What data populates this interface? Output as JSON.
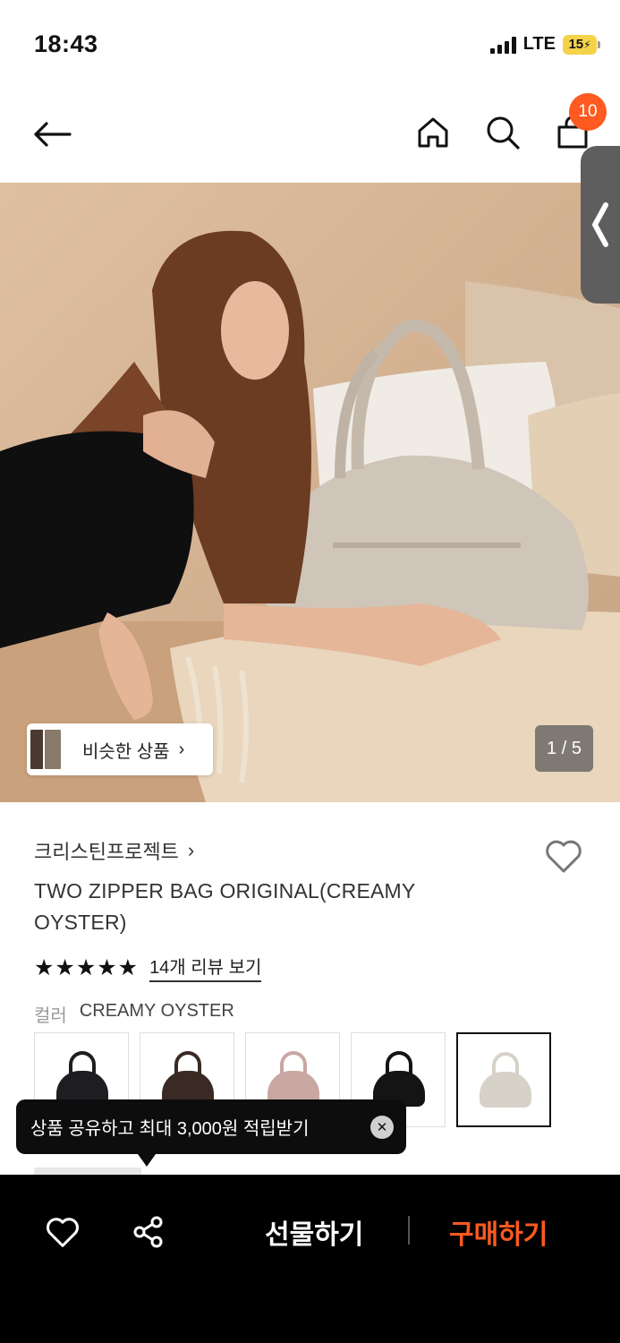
{
  "status_bar": {
    "time": "18:43",
    "network": "LTE",
    "battery": "15"
  },
  "nav": {
    "back_icon": "arrow-left-icon",
    "home_icon": "home-icon",
    "search_icon": "search-icon",
    "cart_icon": "shopping-bag-icon",
    "cart_count": "10"
  },
  "hero": {
    "similar_label": "비슷한 상품",
    "similar_arrow": "›",
    "page_indicator": "1 / 5"
  },
  "product": {
    "brand": "크리스틴프로젝트",
    "brand_arrow": "›",
    "title": "TWO ZIPPER BAG ORIGINAL(CREAMY OYSTER)",
    "stars": "★★★★★",
    "review_link": "14개 리뷰 보기",
    "color_key": "컬러",
    "color_value": "CREAMY OYSTER",
    "swatches": [
      {
        "name": "black",
        "color": "#1e1e22"
      },
      {
        "name": "brown",
        "color": "#3a2a24"
      },
      {
        "name": "pink",
        "color": "#c9a7a2"
      },
      {
        "name": "black-2",
        "color": "#141414"
      },
      {
        "name": "creamy-oyster",
        "color": "#d7d2c8",
        "selected": true
      }
    ]
  },
  "tooltip": {
    "text": "상품 공유하고 최대 3,000원 적립받기",
    "close": "✕"
  },
  "bottom_bar": {
    "gift_label": "선물하기",
    "buy_label": "구매하기",
    "accent": "#ff5a1f"
  }
}
